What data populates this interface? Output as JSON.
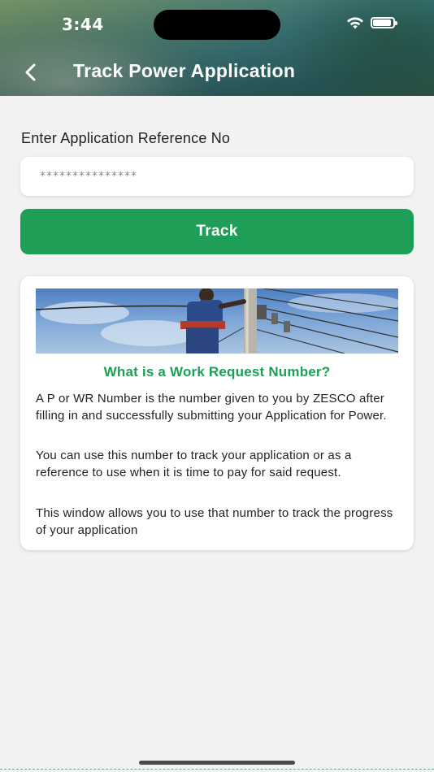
{
  "status_bar": {
    "time": "3:44"
  },
  "header": {
    "title": "Track Power Application",
    "back_icon": "chevron-left-icon"
  },
  "form": {
    "label": "Enter Application Reference No",
    "input_placeholder": "***************",
    "input_value": "",
    "track_label": "Track"
  },
  "info": {
    "heading": "What is a Work Request Number?",
    "paragraphs": [
      "A P or WR Number is the number given to you by ZESCO after filling in and successfully submitting your Application for Power.",
      "You can use this number to track your application or as a reference to use when it is time to pay for said request.",
      "This window allows you to use that number to track the progress of your application"
    ]
  },
  "colors": {
    "accent": "#1e9e57",
    "background": "#f2f2f2"
  }
}
